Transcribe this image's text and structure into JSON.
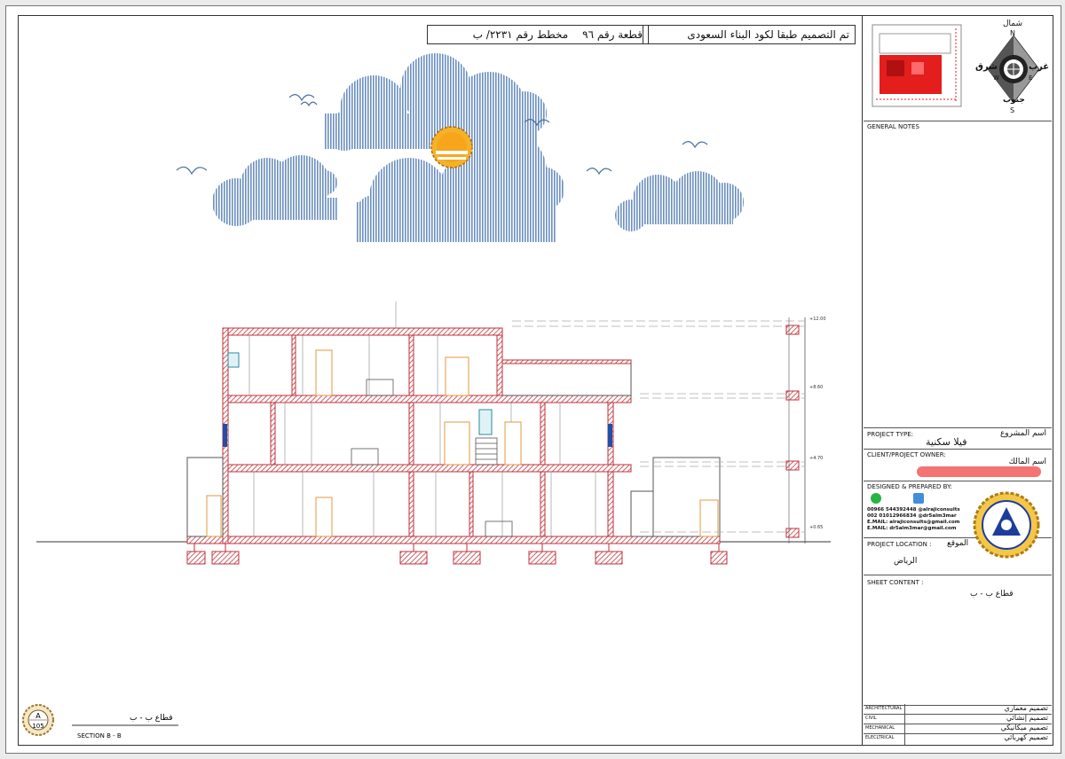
{
  "title_block": {
    "code_note": "تم التصميم طبقا لكود البناء السعودى",
    "plot_label": "قطعة رقم ٩٦",
    "scheme_label": "مخطط رقم ٢٢٣١/ ب"
  },
  "drawing": {
    "caption_ar": "قطاع ب - ب",
    "caption_en": "SECTION B - B",
    "sheet_no": "105",
    "sheet_prefix": "A",
    "levels": [
      "+12.00",
      "+8.60",
      "+4.70",
      "+0.65"
    ]
  },
  "compass": {
    "north_ar": "شمال",
    "south_ar": "جنوب",
    "east_ar": "شرق",
    "west_ar": "غرب",
    "n": "N",
    "s": "S",
    "e": "E",
    "w": "W"
  },
  "panel": {
    "general_notes": "GENERAL NOTES",
    "project_type_label": "PROJECT TYPE:",
    "project_type_label_ar": "اسم المشروع",
    "project_type_value": "فيلا سكنية",
    "owner_label": "CLIENT/PROJECT OWNER:",
    "owner_label_ar": "اسم المالك",
    "designed_label": "DESIGNED & PREPARED BY:",
    "contact_lines": [
      "00966 544392448   @alrajiconsults",
      "002 01012966834   @dr5alm3mar",
      "E.MAIL:  alrajiconsults@gmail.com",
      "E.MAIL:  dr5alm3mar@gmail.com"
    ],
    "location_label": "PROJECT LOCATION :",
    "location_label_ar": "الموقع",
    "location_value": "الرياض",
    "sheet_content_label": "SHEET CONTENT :",
    "sheet_content_value": "قطاع ب - ب",
    "disciplines": [
      {
        "en": "ARCHITECTURAL",
        "ar": "تصميم معماري"
      },
      {
        "en": "CIVIL",
        "ar": "تصميم إنشائي"
      },
      {
        "en": "MECHANICAL",
        "ar": "تصميم ميكانيكي"
      },
      {
        "en": "ELECLTRICAL",
        "ar": "تصميم كهربائي"
      }
    ]
  }
}
